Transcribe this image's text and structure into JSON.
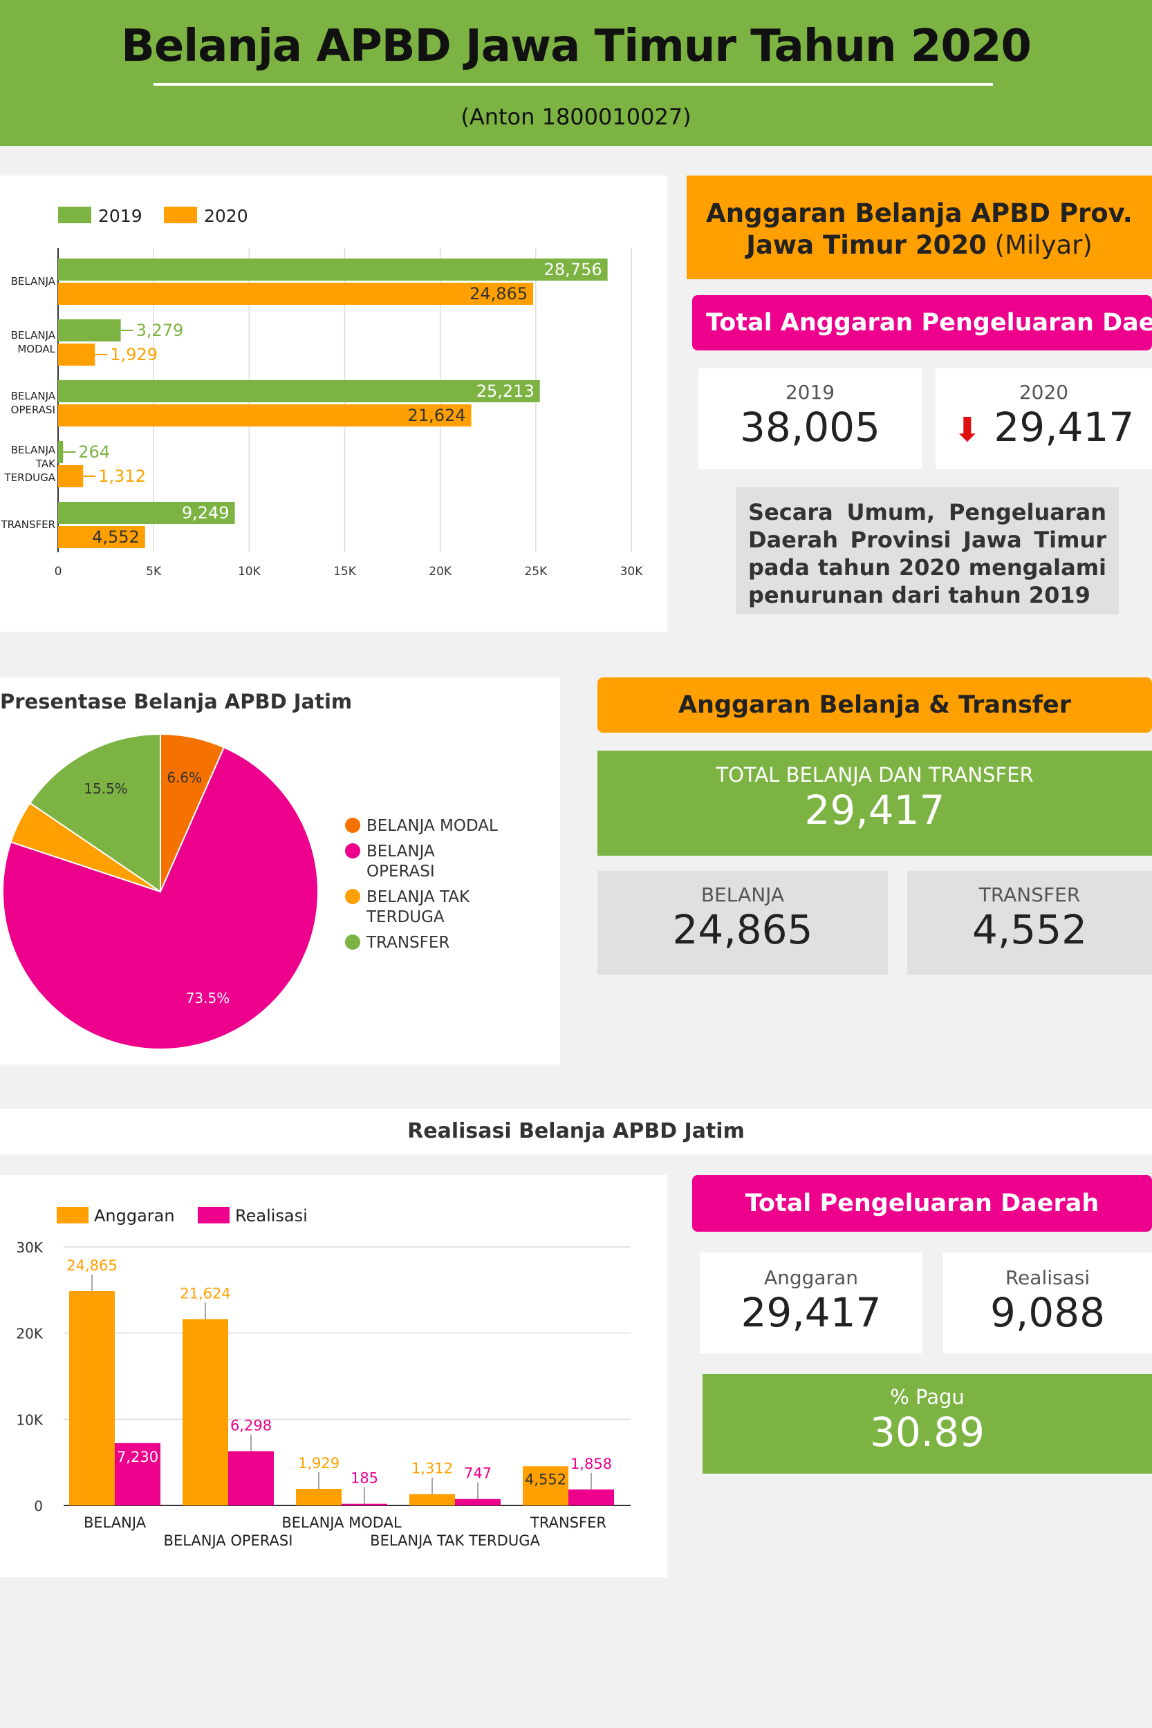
{
  "header": {
    "title": "Belanja APBD Jawa Timur Tahun 2020",
    "subtitle": "(Anton 1800010027)"
  },
  "summary1": {
    "heading_bold": "Anggaran Belanja APBD Prov. Jawa Timur 2020",
    "heading_unit": "(Milyar)",
    "total_label": "Total Anggaran Pengeluaran Daerah",
    "y2019_label": "2019",
    "y2019_value": "38,005",
    "y2020_label": "2020",
    "y2020_value": "29,417",
    "trend_icon": "arrow-down-icon",
    "note": "Secara Umum, Pengeluaran Daerah Provinsi Jawa Timur pada tahun 2020 mengalami penurunan dari tahun 2019"
  },
  "summary2": {
    "heading": "Anggaran Belanja & Transfer",
    "total_label": "TOTAL BELANJA DAN TRANSFER",
    "total_value": "29,417",
    "belanja_label": "BELANJA",
    "belanja_value": "24,865",
    "transfer_label": "TRANSFER",
    "transfer_value": "4,552"
  },
  "section3_title": "Realisasi Belanja APBD Jatim",
  "summary3": {
    "heading": "Total Pengeluaran Daerah",
    "anggaran_label": "Anggaran",
    "anggaran_value": "29,417",
    "realisasi_label": "Realisasi",
    "realisasi_value": "9,088",
    "pagu_label": "% Pagu",
    "pagu_value": "30.89"
  },
  "colors": {
    "green": "#7cb342",
    "orange": "#ffa000",
    "magenta": "#ec008c",
    "dark_orange": "#f57100"
  },
  "chart_data": [
    {
      "type": "bar",
      "orientation": "horizontal",
      "categories": [
        [
          "BELANJA"
        ],
        [
          "BELANJA",
          "MODAL"
        ],
        [
          "BELANJA",
          "OPERASI"
        ],
        [
          "BELANJA",
          "TAK",
          "TERDUGA"
        ],
        [
          "TRANSFER"
        ]
      ],
      "series": [
        {
          "name": "2019",
          "values": [
            28756,
            3279,
            25213,
            264,
            9249
          ],
          "labels": [
            "28,756",
            "3,279",
            "25,213",
            "264",
            "9,249"
          ]
        },
        {
          "name": "2020",
          "values": [
            24865,
            1929,
            21624,
            1312,
            4552
          ],
          "labels": [
            "24,865",
            "1,929",
            "21,624",
            "1,312",
            "4,552"
          ]
        }
      ],
      "xlim": [
        0,
        30000
      ],
      "ticks": [
        0,
        5000,
        10000,
        15000,
        20000,
        25000,
        30000
      ],
      "tick_labels": [
        "0",
        "5K",
        "10K",
        "15K",
        "20K",
        "25K",
        "30K"
      ],
      "grid": true,
      "legend": "top-left"
    },
    {
      "type": "pie",
      "title": "Presentase Belanja APBD Jatim",
      "slices": [
        {
          "name": "BELANJA MODAL",
          "value": 6.6,
          "label": "6.6%",
          "color": "#f57100"
        },
        {
          "name": "BELANJA OPERASI",
          "value": 73.5,
          "label": "73.5%",
          "color": "#ec008c"
        },
        {
          "name": "BELANJA TAK TERDUGA",
          "value": 4.4,
          "label": "",
          "color": "#ffa000"
        },
        {
          "name": "TRANSFER",
          "value": 15.5,
          "label": "15.5%",
          "color": "#7cb342"
        }
      ],
      "legend_lines": [
        [
          "BELANJA MODAL"
        ],
        [
          "BELANJA",
          "OPERASI"
        ],
        [
          "BELANJA TAK",
          "TERDUGA"
        ],
        [
          "TRANSFER"
        ]
      ],
      "legend": "right"
    },
    {
      "type": "bar",
      "orientation": "vertical",
      "categories": [
        "BELANJA",
        "BELANJA OPERASI",
        "BELANJA MODAL",
        "BELANJA TAK TERDUGA",
        "TRANSFER"
      ],
      "series": [
        {
          "name": "Anggaran",
          "values": [
            24865,
            21624,
            1929,
            1312,
            4552
          ],
          "labels": [
            "24,865",
            "21,624",
            "1,929",
            "1,312",
            "4,552"
          ]
        },
        {
          "name": "Realisasi",
          "values": [
            7230,
            6298,
            185,
            747,
            1858
          ],
          "labels": [
            "7,230",
            "6,298",
            "185",
            "747",
            "1,858"
          ]
        }
      ],
      "ylim": [
        0,
        30000
      ],
      "ticks": [
        0,
        10000,
        20000,
        30000
      ],
      "tick_labels": [
        "0",
        "10K",
        "20K",
        "30K"
      ],
      "grid": true,
      "legend": "top-left"
    }
  ]
}
